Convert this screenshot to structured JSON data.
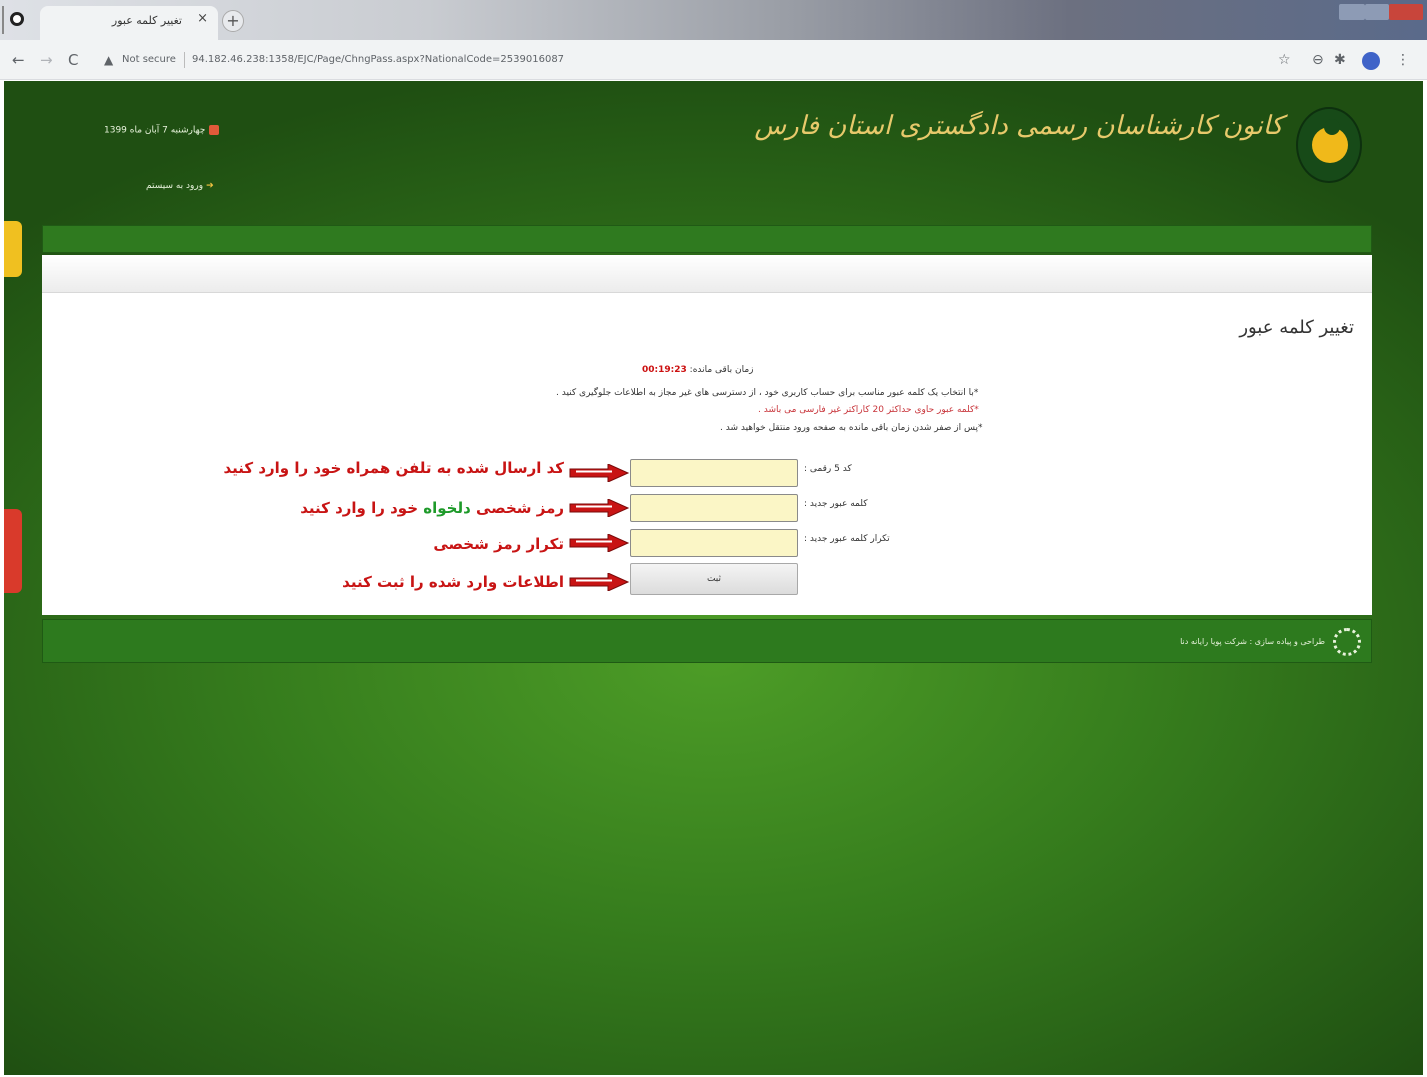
{
  "browser": {
    "tab_title": "تغییر کلمه عبور",
    "tab_close": "×",
    "new_tab": "+",
    "not_secure": "Not secure",
    "url": "94.182.46.238:1358/EJC/Page/ChngPass.aspx?NationalCode=2539016087"
  },
  "header": {
    "date": "چهارشنبه 7 آبان ماه 1399",
    "login_link": "ورود به سیستم",
    "org_title": "کانون کارشناسان رسمی دادگستری استان فارس"
  },
  "form": {
    "page_title": "تغییر کلمه عبور",
    "timer_label": "زمان باقی مانده:",
    "timer_value": "00:19:23",
    "notes": [
      "*با انتخاب یک کلمه عبور مناسب برای حساب کاربری خود ، از دسترسی های غیر مجاز به اطلاعات جلوگیری کنید .",
      "*کلمه عبور حاوی حداکثر 20 کاراکتر غیر فارسی می باشد .",
      "*پس از صفر شدن زمان باقی مانده به صفحه ورود منتقل خواهید شد ."
    ],
    "code_label": "کد 5 رقمی :",
    "new_password_label": "کلمه عبور جدید :",
    "repeat_password_label": "تکرار کلمه عبور جدید :",
    "submit_label": "ثبت"
  },
  "annotations": {
    "a1": "کد ارسال شده به تلفن همراه خود را وارد کنید",
    "a2_part1": "رمز شخصی ",
    "a2_green": "دلخواه",
    "a2_part2": " خود را وارد کنید",
    "a3": "تکرار رمز شخصی",
    "a4": "اطلاعات وارد شده را ثبت کنید"
  },
  "footer": {
    "text": "طراحی و پیاده سازی : شرکت پویا رایانه دنا"
  },
  "colors": {
    "page_green": "#367d1d",
    "annotation_red": "#c81414",
    "input_yellow": "#fbf6c6"
  }
}
